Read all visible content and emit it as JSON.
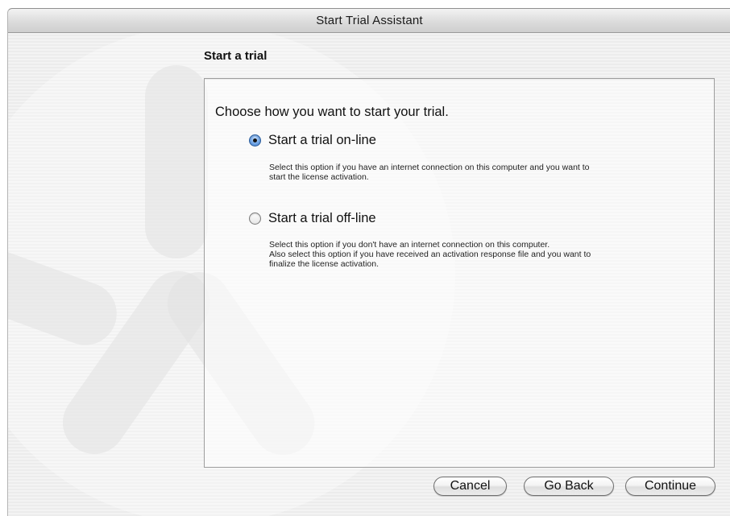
{
  "window": {
    "title": "Start Trial Assistant"
  },
  "section": {
    "heading": "Start a trial"
  },
  "content": {
    "prompt": "Choose how you want to start your trial.",
    "options": [
      {
        "label": "Start a trial on-line",
        "selected": true,
        "description": [
          "Select this option if you have an internet connection on this computer and you want to",
          "start the license activation."
        ]
      },
      {
        "label": "Start a trial off-line",
        "selected": false,
        "description": [
          "Select this option if you don't have an internet connection on this computer.",
          "Also select this option if you have received an activation response file and you want to",
          "finalize the license activation."
        ]
      }
    ]
  },
  "buttons": {
    "cancel": "Cancel",
    "go_back": "Go Back",
    "continue": "Continue"
  },
  "icons": {
    "background": "asterisk-watermark-icon",
    "radio_selected": "radio-selected-icon",
    "radio_unselected": "radio-unselected-icon"
  },
  "colors": {
    "radio_accent": "#3a78c8",
    "window_background": "#ececec"
  }
}
